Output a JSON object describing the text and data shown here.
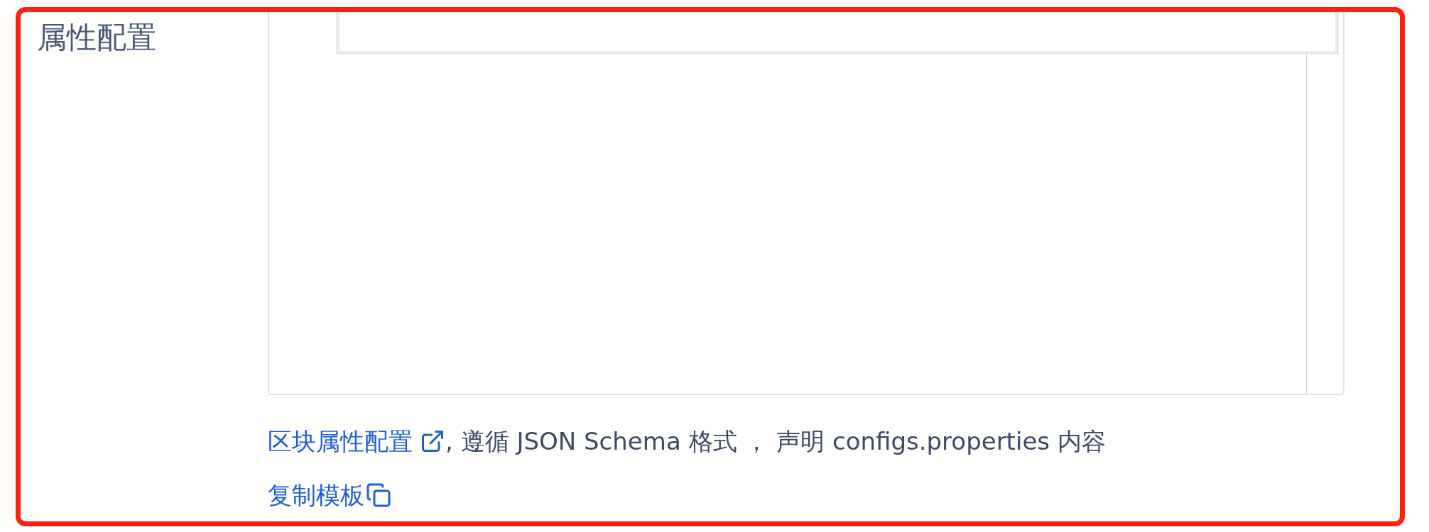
{
  "field": {
    "label": "属性配置"
  },
  "help": {
    "link": "区块属性配置",
    "text": ", 遵循 JSON Schema 格式 ， 声明 configs.properties 内容"
  },
  "copy_link": "复制模板"
}
